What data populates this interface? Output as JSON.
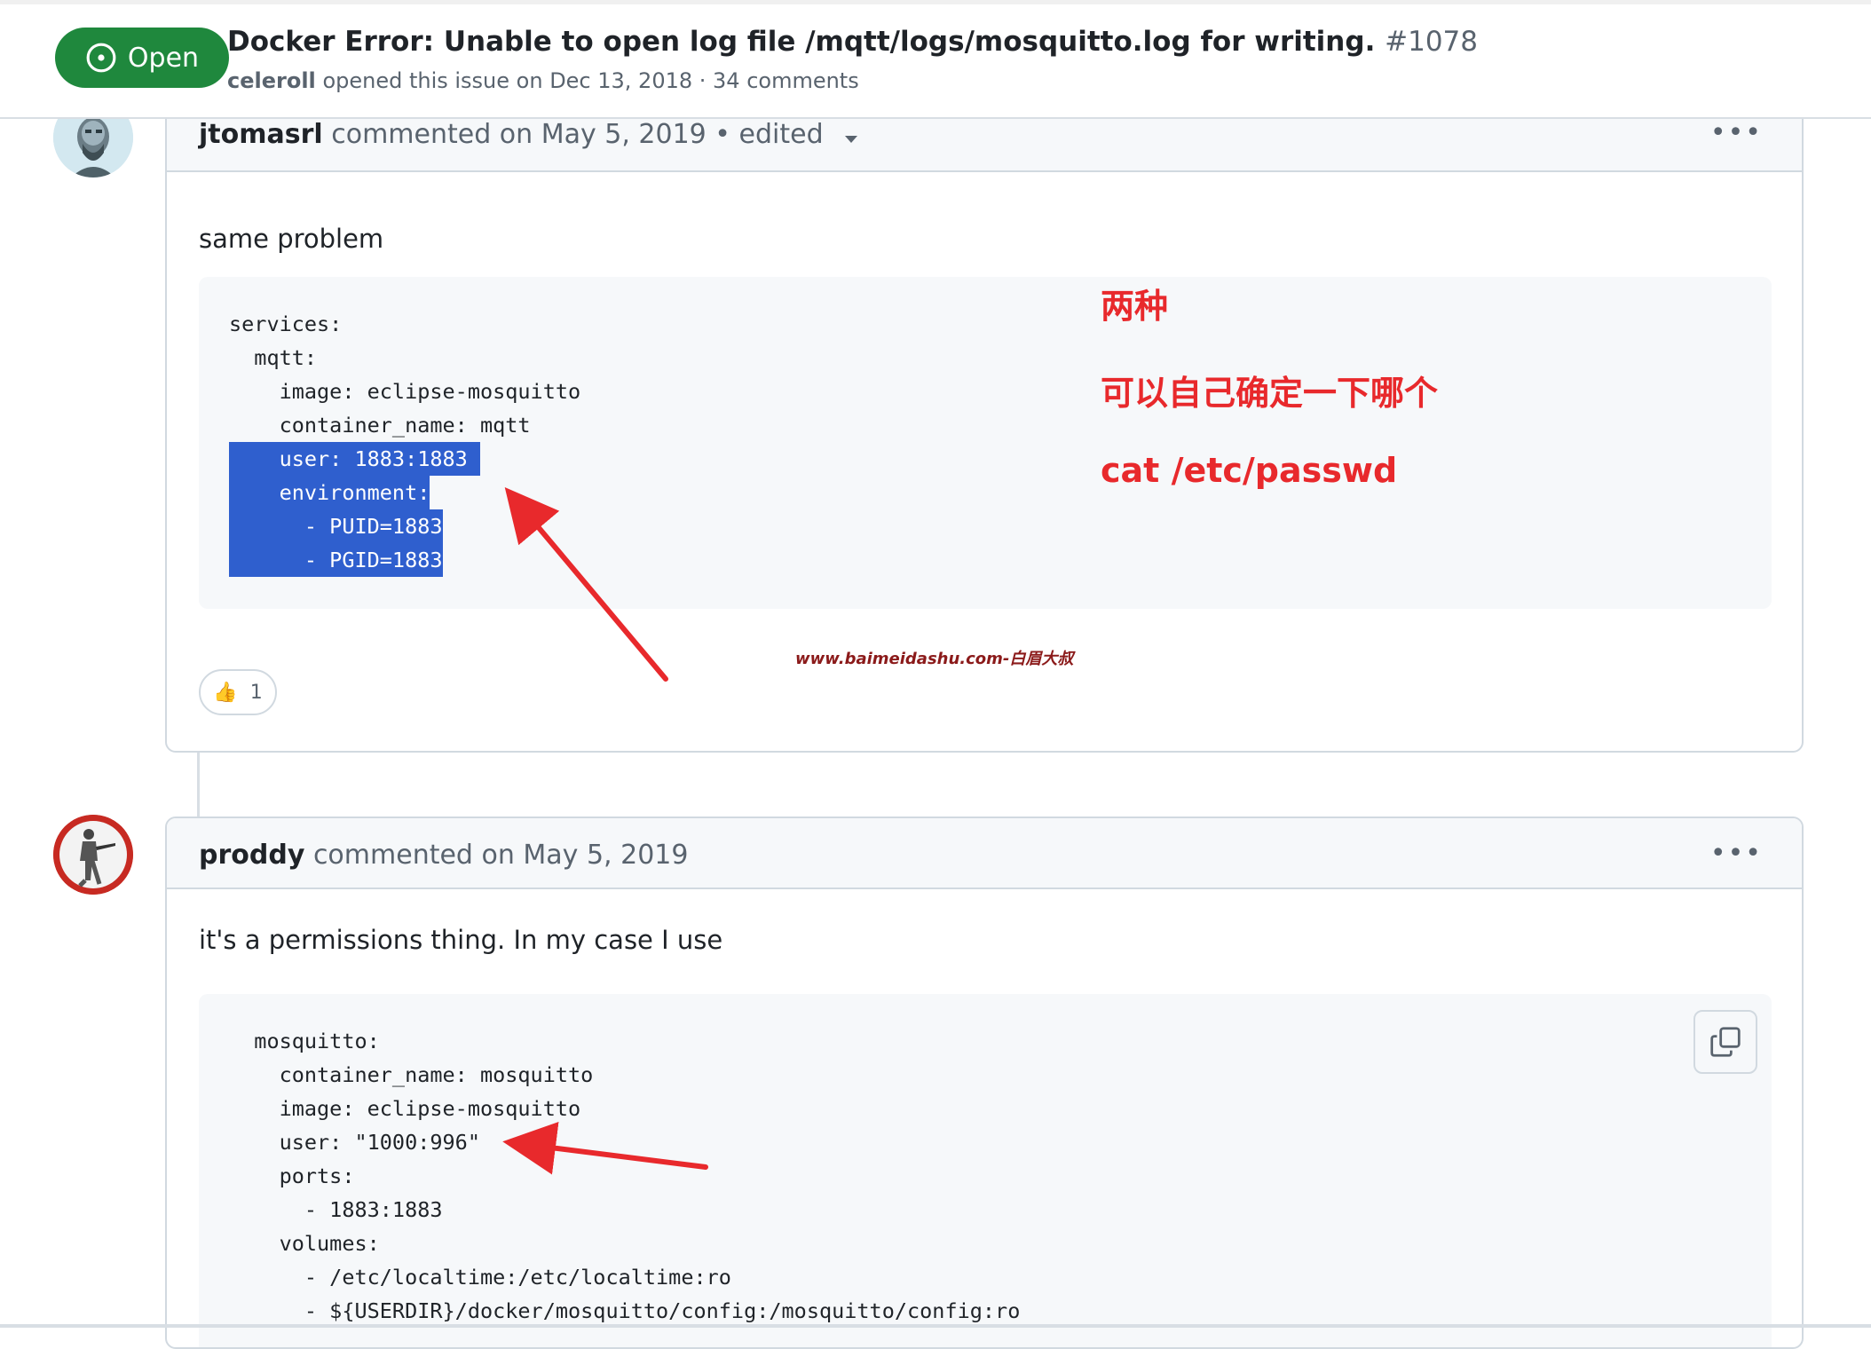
{
  "issue": {
    "status": "Open",
    "title": "Docker Error: Unable to open log file /mqtt/logs/mosquitto.log for writing.",
    "number": "#1078",
    "author": "celeroll",
    "meta": "opened this issue on Dec 13, 2018 · 34 comments"
  },
  "comments": [
    {
      "author": "jtomasrl",
      "meta": "commented on May 5, 2019 • edited",
      "body": "same problem",
      "code": [
        {
          "text": "services:",
          "hl": false
        },
        {
          "text": "  mqtt:",
          "hl": false
        },
        {
          "text": "    image: eclipse-mosquitto",
          "hl": false
        },
        {
          "text": "    container_name: mqtt",
          "hl": false
        },
        {
          "text": "    user: 1883:1883 ",
          "hl": true
        },
        {
          "text": "    environment:",
          "hl": true
        },
        {
          "text": "      - PUID=1883",
          "hl": true
        },
        {
          "text": "      - PGID=1883",
          "hl": true
        }
      ],
      "reaction_emoji": "👍",
      "reaction_count": "1"
    },
    {
      "author": "proddy",
      "meta": "commented on May 5, 2019",
      "body": "it's a permissions thing. In my case I use",
      "code": [
        "  mosquitto:",
        "    container_name: mosquitto",
        "    image: eclipse-mosquitto",
        "    user: \"1000:996\"",
        "    ports:",
        "      - 1883:1883",
        "    volumes:",
        "      - /etc/localtime:/etc/localtime:ro",
        "      - ${USERDIR}/docker/mosquitto/config:/mosquitto/config:ro"
      ]
    }
  ],
  "annotations": {
    "line1": "两种",
    "line2": "可以自己确定一下哪个",
    "line3": "cat /etc/passwd",
    "watermark": "www.baimeidashu.com-白眉大叔",
    "color": "#e8292c"
  },
  "icons": {
    "status": "issue-opened-icon",
    "more": "kebab-horizontal-icon",
    "caret": "triangle-down-icon",
    "copy": "copy-icon"
  },
  "colors": {
    "open_green": "#1f883d",
    "selection_blue": "#2f5fce"
  }
}
